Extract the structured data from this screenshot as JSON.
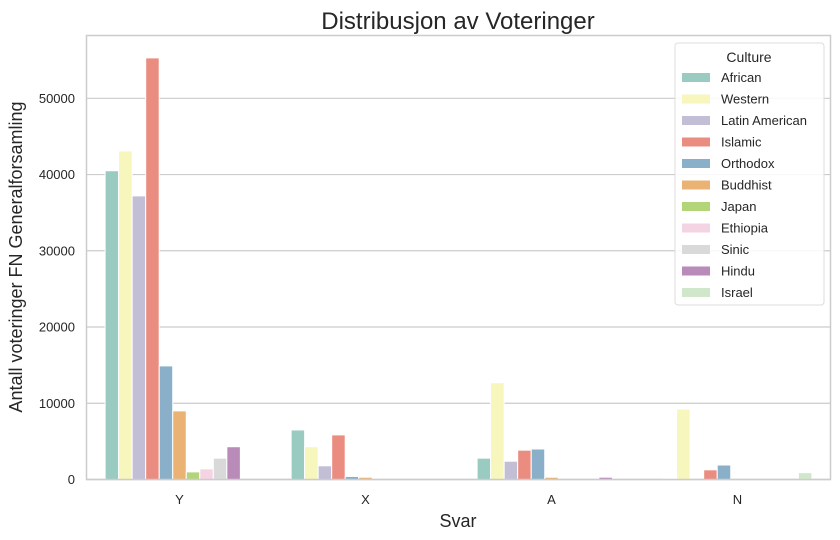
{
  "chart_data": {
    "type": "bar",
    "title": "Distribusjon av Voteringer",
    "xlabel": "Svar",
    "ylabel": "Antall voteringer FN Generalforsamling",
    "categories": [
      "Y",
      "X",
      "A",
      "N"
    ],
    "ylim": [
      0,
      58000
    ],
    "yticks": [
      0,
      10000,
      20000,
      30000,
      40000,
      50000
    ],
    "ytick_labels": [
      "0",
      "10000",
      "20000",
      "30000",
      "40000",
      "50000"
    ],
    "grid": true,
    "legend": {
      "title": "Culture",
      "position": "top-right"
    },
    "series": [
      {
        "name": "African",
        "color": "#9acbc1",
        "values": [
          40500,
          6500,
          2800,
          100
        ]
      },
      {
        "name": "Western",
        "color": "#f6f6bd",
        "values": [
          43100,
          4300,
          12700,
          9250
        ]
      },
      {
        "name": "Latin American",
        "color": "#c1bed6",
        "values": [
          37200,
          1800,
          2400,
          0
        ]
      },
      {
        "name": "Islamic",
        "color": "#ea8c80",
        "values": [
          55300,
          5850,
          3850,
          1270
        ]
      },
      {
        "name": "Orthodox",
        "color": "#8aafc9",
        "values": [
          14900,
          400,
          4000,
          1900
        ]
      },
      {
        "name": "Buddhist",
        "color": "#eab374",
        "values": [
          9000,
          300,
          300,
          0
        ]
      },
      {
        "name": "Japan",
        "color": "#b4d47a",
        "values": [
          1000,
          0,
          0,
          0
        ]
      },
      {
        "name": "Ethiopia",
        "color": "#f4d3e3",
        "values": [
          1400,
          0,
          0,
          0
        ]
      },
      {
        "name": "Sinic",
        "color": "#d9d9d9",
        "values": [
          2800,
          0,
          0,
          0
        ]
      },
      {
        "name": "Hindu",
        "color": "#b88bb9",
        "values": [
          4300,
          0,
          300,
          0
        ]
      },
      {
        "name": "Israel",
        "color": "#d1e7cb",
        "values": [
          0,
          0,
          0,
          900
        ]
      }
    ]
  }
}
